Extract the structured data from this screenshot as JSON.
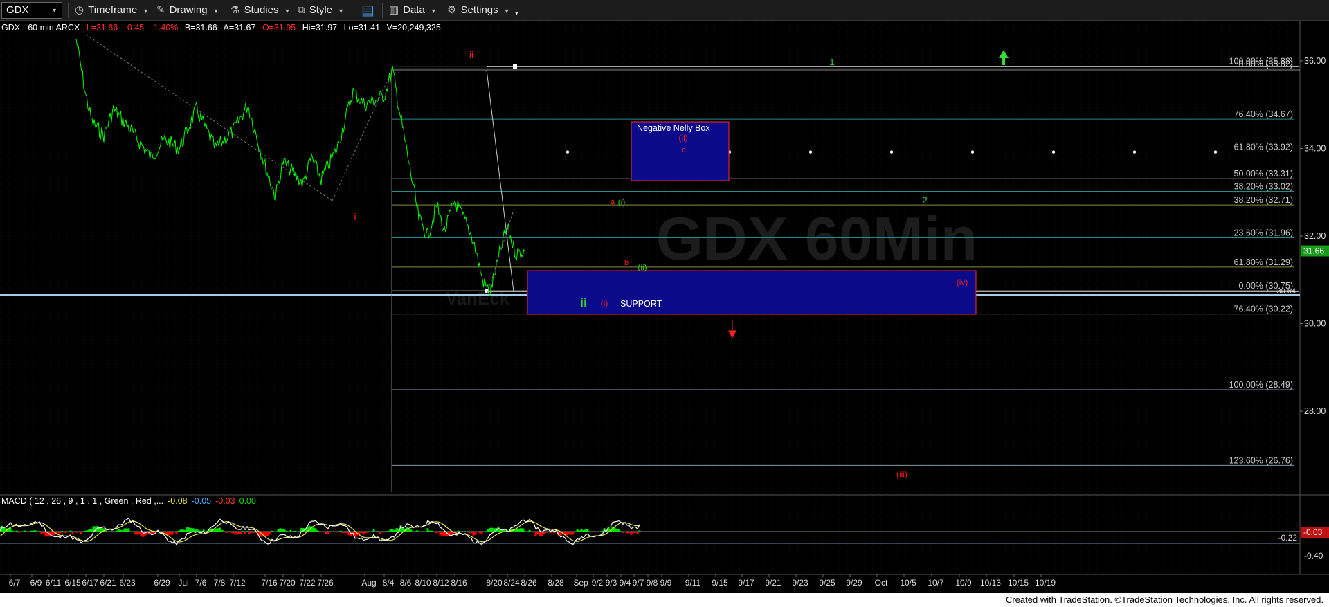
{
  "toolbar": {
    "symbol": "GDX",
    "timeframe": "Timeframe",
    "drawing": "Drawing",
    "studies": "Studies",
    "style": "Style",
    "data": "Data",
    "settings": "Settings"
  },
  "header": {
    "title": "GDX - 60 min  ARCX",
    "last": "L=31.66",
    "change": "-0.45",
    "pct": "-1.40%",
    "bid": "B=31.66",
    "ask": "A=31.67",
    "open": "O=31.95",
    "high": "Hi=31.97",
    "low": "Lo=31.41",
    "volume": "V=20,249,325"
  },
  "watermark": {
    "main": "GDX 60Min",
    "sub": "VanEck"
  },
  "colors": {
    "price": "#00ff00",
    "red_label": "#ff1a1a",
    "green_label": "#33cc33",
    "box_fill": "#0a0a8a",
    "box_border": "#ff2a2a",
    "macd_line": "#ffffff",
    "signal_line": "#e8e84a",
    "hist_pos": "#00dd00",
    "hist_neg": "#ff0000",
    "fib_teal": "#2a8a8a",
    "fib_olive": "#8a8a3a",
    "fib_grey": "#8a8a8a"
  },
  "fib_levels": [
    {
      "label": "100.00% (35.88)",
      "price": 35.88,
      "color": "#b8b8b8"
    },
    {
      "label": "0.00% (35.82)",
      "price": 35.82,
      "color": "#b8b8b8"
    },
    {
      "label": "76.40% (34.67)",
      "price": 34.67,
      "color": "#2a8a8a"
    },
    {
      "label": "61.80% (33.92)",
      "price": 33.92,
      "color": "#8a8a3a"
    },
    {
      "label": "50.00% (33.31)",
      "price": 33.31,
      "color": "#8a8a8a"
    },
    {
      "label": "38.20% (33.02)",
      "price": 33.02,
      "color": "#2a8a8a"
    },
    {
      "label": "38.20% (32.71)",
      "price": 32.71,
      "color": "#8a8a3a"
    },
    {
      "label": "23.60% (31.96)",
      "price": 31.96,
      "color": "#2a8a8a"
    },
    {
      "label": "61.80% (31.29)",
      "price": 31.29,
      "color": "#8a8a3a"
    },
    {
      "label": "0.00% (30.75)",
      "price": 30.75,
      "color": "#b8b8b8"
    },
    {
      "label": "76.40% (30.22)",
      "price": 30.22,
      "color": "#8a9aaa"
    },
    {
      "label": "100.00% (28.49)",
      "price": 28.49,
      "color": "#8a9aaa"
    },
    {
      "label": "123.60% (26.76)",
      "price": 26.76,
      "color": "#8a9aaa"
    }
  ],
  "chart_data": [
    {
      "type": "line",
      "title": "GDX - 60 min",
      "y_axis": {
        "ticks": [
          36.0,
          34.0,
          32.0,
          30.0,
          28.0
        ],
        "range": [
          25.7,
          36.8
        ]
      },
      "x_ticks": [
        "6/7",
        "6/9",
        "6/11",
        "6/15",
        "6/17",
        "6/21",
        "6/23",
        "6/29",
        "Jul",
        "7/6",
        "7/8",
        "7/12",
        "7/16",
        "7/20",
        "7/22",
        "7/26",
        "Aug",
        "8/4",
        "8/6",
        "8/10",
        "8/12",
        "8/16",
        "8/20",
        "8/24",
        "8/26",
        "8/28",
        "Sep",
        "9/2",
        "9/3",
        "9/4",
        "9/7",
        "9/8",
        "9/9",
        "9/11",
        "9/15",
        "9/17",
        "9/21",
        "9/23",
        "9/25",
        "9/29",
        "Oct",
        "10/5",
        "10/7",
        "10/9",
        "10/13",
        "10/15",
        "10/19"
      ],
      "last_price": "31.66",
      "level_30_64": "30.64",
      "price_path": [
        {
          "d": "6/16",
          "p": 36.5
        },
        {
          "d": "6/17",
          "p": 35.2
        },
        {
          "d": "6/18",
          "p": 34.6
        },
        {
          "d": "6/21",
          "p": 34.3
        },
        {
          "d": "6/22",
          "p": 34.9
        },
        {
          "d": "6/24",
          "p": 34.5
        },
        {
          "d": "6/28",
          "p": 33.8
        },
        {
          "d": "6/30",
          "p": 34.2
        },
        {
          "d": "7/1",
          "p": 34.0
        },
        {
          "d": "7/6",
          "p": 34.9
        },
        {
          "d": "7/8",
          "p": 34.0
        },
        {
          "d": "7/12",
          "p": 34.4
        },
        {
          "d": "7/14",
          "p": 35.0
        },
        {
          "d": "7/16",
          "p": 33.6
        },
        {
          "d": "7/19",
          "p": 32.9
        },
        {
          "d": "7/20",
          "p": 33.7
        },
        {
          "d": "7/22",
          "p": 33.2
        },
        {
          "d": "7/23",
          "p": 33.8
        },
        {
          "d": "7/26",
          "p": 33.3
        },
        {
          "d": "7/28",
          "p": 34.0
        },
        {
          "d": "7/30",
          "p": 35.3
        },
        {
          "d": "8/2",
          "p": 35.0
        },
        {
          "d": "8/4",
          "p": 35.2
        },
        {
          "d": "8/5",
          "p": 35.8
        },
        {
          "d": "8/6",
          "p": 34.6
        },
        {
          "d": "8/9",
          "p": 33.3
        },
        {
          "d": "8/10",
          "p": 32.4
        },
        {
          "d": "8/11",
          "p": 32.0
        },
        {
          "d": "8/12",
          "p": 32.7
        },
        {
          "d": "8/13",
          "p": 32.1
        },
        {
          "d": "8/16",
          "p": 32.8
        },
        {
          "d": "8/17",
          "p": 32.4
        },
        {
          "d": "8/18",
          "p": 31.9
        },
        {
          "d": "8/19",
          "p": 31.0
        },
        {
          "d": "8/20",
          "p": 30.7
        },
        {
          "d": "8/23",
          "p": 31.8
        },
        {
          "d": "8/24",
          "p": 32.2
        },
        {
          "d": "8/25",
          "p": 31.6
        },
        {
          "d": "8/26",
          "p": 31.66
        }
      ],
      "wave_labels": [
        {
          "text": "ii",
          "color": "red"
        },
        {
          "text": "i",
          "color": "red"
        },
        {
          "text": "a",
          "color": "red"
        },
        {
          "text": "(i)",
          "color": "green"
        },
        {
          "text": "b",
          "color": "red"
        },
        {
          "text": "(ii)",
          "color": "green"
        },
        {
          "text": "ii",
          "color": "green"
        },
        {
          "text": "(i)",
          "color": "red"
        },
        {
          "text": "1",
          "color": "green"
        },
        {
          "text": "2",
          "color": "green"
        },
        {
          "text": "(iv)",
          "color": "red"
        },
        {
          "text": "(iii)",
          "color": "red"
        },
        {
          "text": "(ii)",
          "color": "red"
        },
        {
          "text": "c",
          "color": "red"
        }
      ],
      "boxes": [
        {
          "label": "Negative Nelly Box",
          "top": 34.67,
          "bottom": 33.31
        },
        {
          "label": "SUPPORT",
          "top": 31.29,
          "bottom": 30.22
        }
      ]
    },
    {
      "type": "line",
      "title": "MACD ( 12 , 26 , 9 , 1 , 1 , Green , Red ,...",
      "values": [
        "-0.08",
        "-0.05",
        "-0.03",
        "0.00"
      ],
      "y_axis": {
        "ticks": [
          -0.22,
          -0.4
        ]
      },
      "last_value": "-0.03"
    }
  ],
  "footer": "Created with TradeStation. ©TradeStation Technologies, Inc. All rights reserved."
}
